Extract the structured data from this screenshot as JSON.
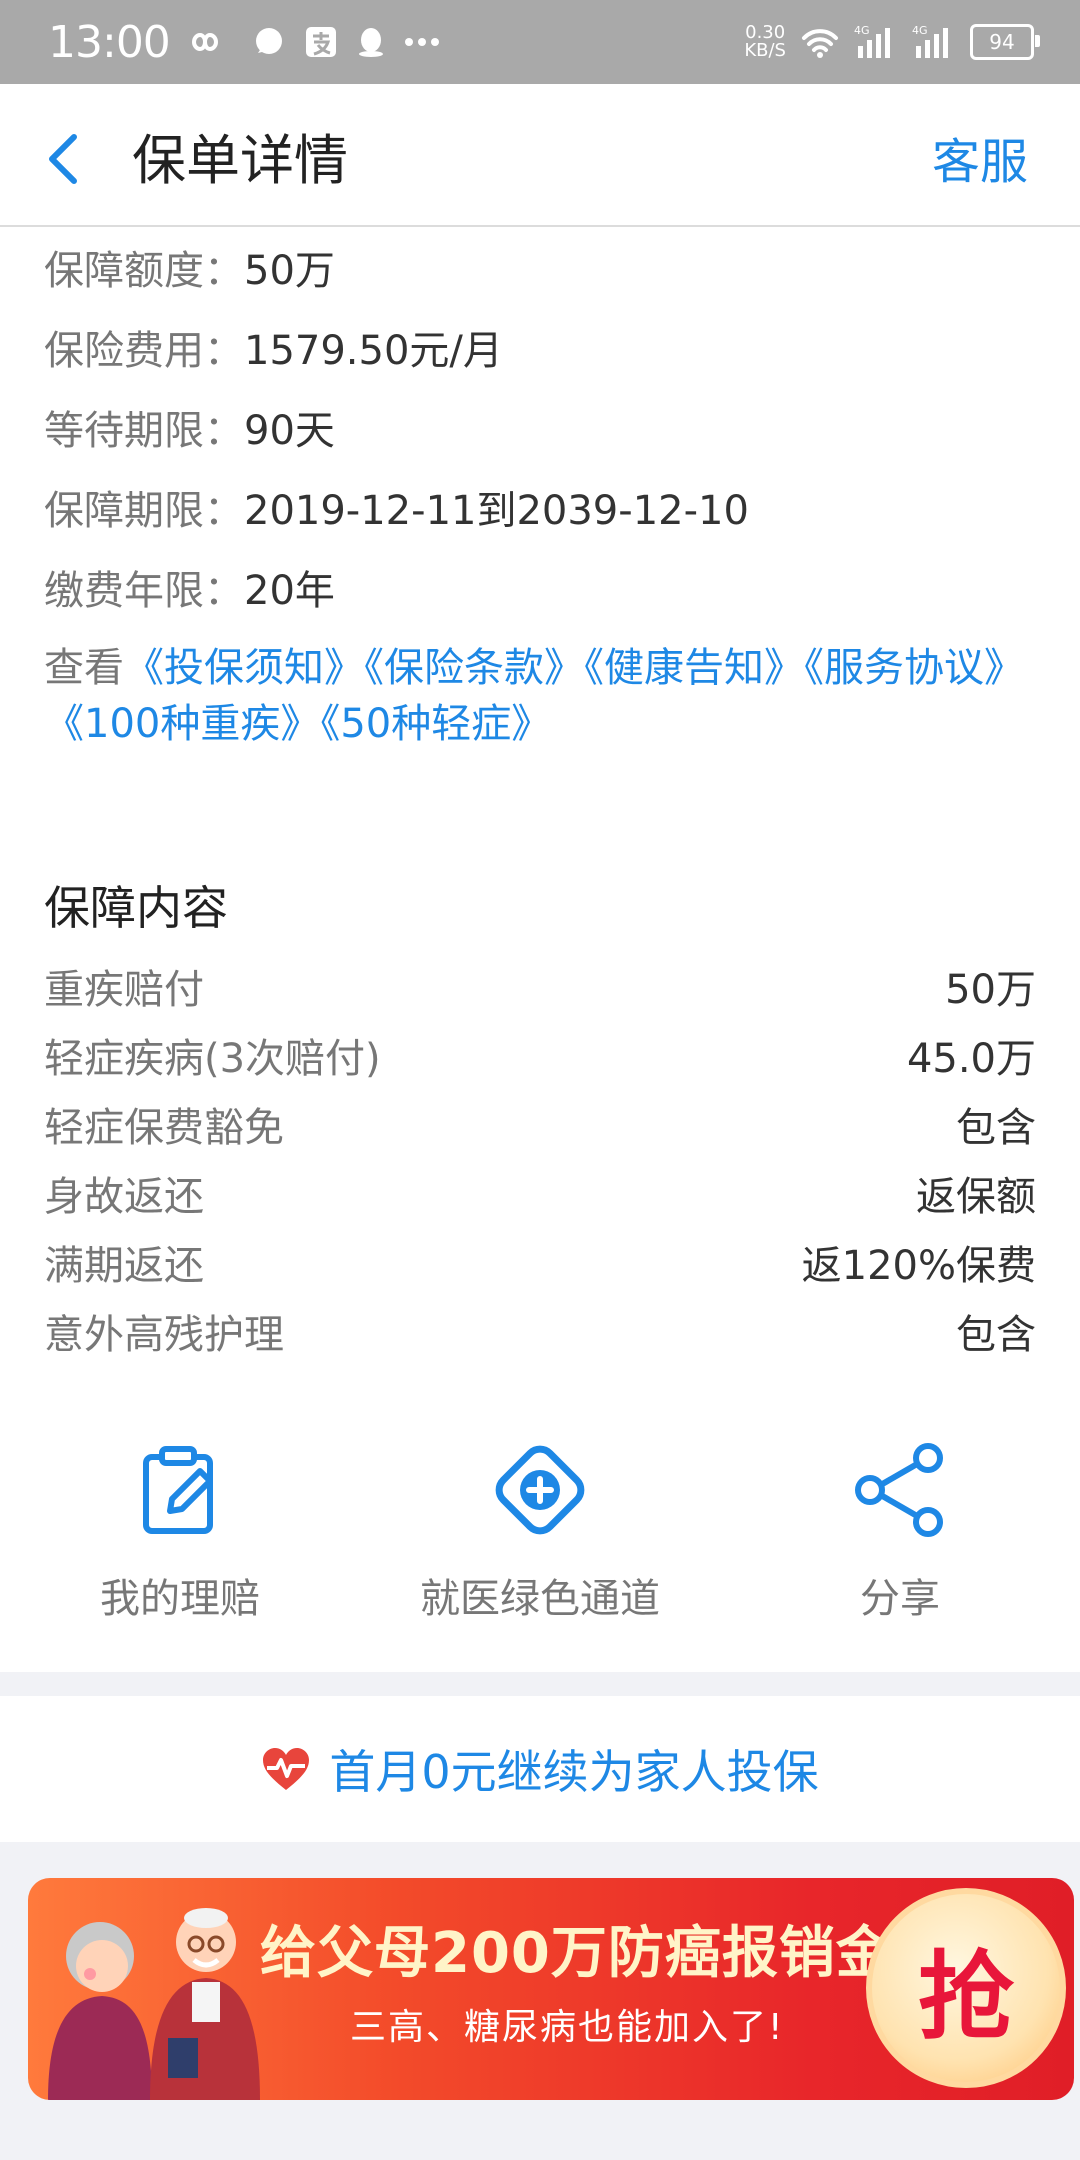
{
  "status_bar": {
    "time": "13:00",
    "net_speed_value": "0.30",
    "net_speed_unit": "KB/S",
    "signal_1_label": "4G",
    "signal_2_label": "4G",
    "battery": "94"
  },
  "header": {
    "title": "保单详情",
    "service": "客服"
  },
  "policy_info": [
    {
      "label": "保障额度：",
      "value": "50万"
    },
    {
      "label": "保险费用：",
      "value": "1579.50元/月"
    },
    {
      "label": "等待期限：",
      "value": "90天"
    },
    {
      "label": "保障期限：",
      "value": "2019-12-11到2039-12-10"
    },
    {
      "label": "缴费年限：",
      "value": "20年"
    }
  ],
  "documents": {
    "prefix": "查看",
    "links": [
      "《投保须知》",
      "《保险条款》",
      "《健康告知》",
      "《服务协议》",
      "《100种重疾》",
      "《50种轻症》"
    ]
  },
  "coverage": {
    "title": "保障内容",
    "rows": [
      {
        "label": "重疾赔付",
        "value": "50万"
      },
      {
        "label": "轻症疾病(3次赔付)",
        "value": "45.0万"
      },
      {
        "label": "轻症保费豁免",
        "value": "包含"
      },
      {
        "label": "身故返还",
        "value": "返保额"
      },
      {
        "label": "满期返还",
        "value": "返120%保费"
      },
      {
        "label": "意外高残护理",
        "value": "包含"
      }
    ]
  },
  "actions": [
    {
      "label": "我的理赔",
      "icon": "clipboard-edit-icon"
    },
    {
      "label": "就医绿色通道",
      "icon": "medical-plus-icon"
    },
    {
      "label": "分享",
      "icon": "share-icon"
    }
  ],
  "promo": {
    "text": "首月0元继续为家人投保",
    "icon": "heart-pulse-icon"
  },
  "banner": {
    "headline": "给父母200万防癌报销金",
    "subline": "三高、糖尿病也能加入了!",
    "button": "抢"
  },
  "colors": {
    "accent": "#1e88e5",
    "status_bar": "#a9a9a9",
    "promo_heart": "#e8453c",
    "banner_red": "#e8262a"
  }
}
